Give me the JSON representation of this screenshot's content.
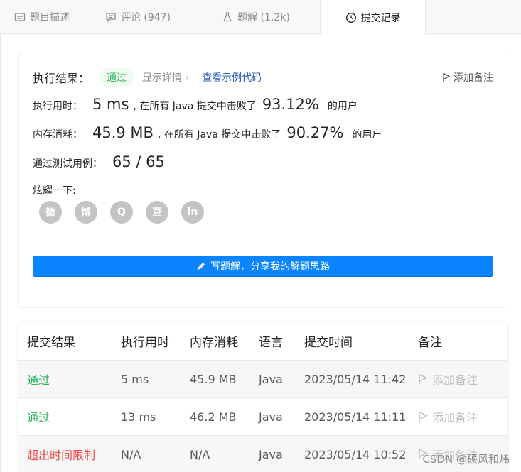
{
  "tabs": [
    {
      "label": "题目描述",
      "icon": "description-icon"
    },
    {
      "label": "评论 (947)",
      "icon": "comment-icon"
    },
    {
      "label": "题解 (1.2k)",
      "icon": "flask-icon"
    },
    {
      "label": "提交记录",
      "icon": "clock-icon"
    }
  ],
  "result": {
    "exec_result_label": "执行结果：",
    "status": "通过",
    "details_link": "显示详情 ›",
    "example_link": "查看示例代码",
    "add_note": "添加备注",
    "runtime_label": "执行用时：",
    "runtime_value": "5 ms",
    "runtime_beat_prefix": ", 在所有 Java 提交中击败了",
    "runtime_pct": "93.12%",
    "beat_suffix": "的用户",
    "memory_label": "内存消耗：",
    "memory_value": "45.9 MB",
    "memory_beat_prefix": ", 在所有 Java 提交中击败了",
    "memory_pct": "90.27%",
    "testcase_label": "通过测试用例：",
    "testcase_value": "65 / 65",
    "share_label": "炫耀一下:",
    "share_icons": [
      "wechat-icon",
      "weibo-icon",
      "qq-icon",
      "douban-icon",
      "linkedin-icon"
    ],
    "share_glyphs": [
      "微",
      "博",
      "Q",
      "豆",
      "in"
    ],
    "write_solution": "写题解，分享我的解题思路"
  },
  "table": {
    "headers": [
      "提交结果",
      "执行用时",
      "内存消耗",
      "语言",
      "提交时间",
      "备注"
    ],
    "rows": [
      {
        "result": "通过",
        "runtime": "5 ms",
        "memory": "45.9 MB",
        "lang": "Java",
        "time": "2023/05/14 11:42",
        "note": "添加备注"
      },
      {
        "result": "通过",
        "runtime": "13 ms",
        "memory": "46.2 MB",
        "lang": "Java",
        "time": "2023/05/14 11:11",
        "note": "添加备注"
      },
      {
        "result": "超出时间限制",
        "runtime": "N/A",
        "memory": "N/A",
        "lang": "Java",
        "time": "2023/05/14 10:52",
        "note": "添加备注"
      }
    ]
  },
  "watermark": "CSDN @硕风和炜",
  "colors": {
    "accent": "#0a84ff",
    "success": "#2db55d",
    "error": "#ef4743",
    "link": "#2861b8"
  }
}
